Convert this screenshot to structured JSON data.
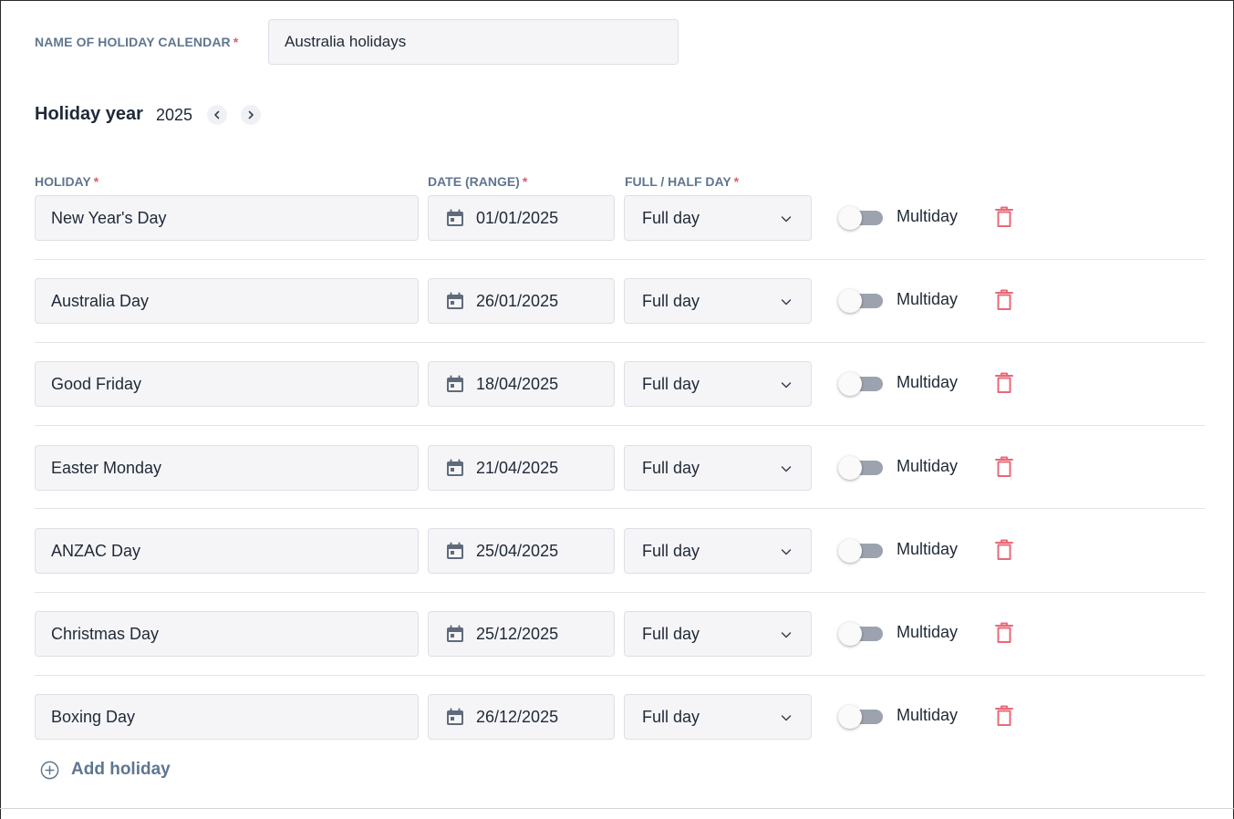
{
  "calendar_name": {
    "label": "NAME OF HOLIDAY CALENDAR",
    "required_mark": "*",
    "value": "Australia holidays"
  },
  "holiday_year": {
    "title": "Holiday year",
    "value": "2025",
    "prev_icon": "chevron-left-icon",
    "next_icon": "chevron-right-icon"
  },
  "columns": {
    "holiday": "HOLIDAY",
    "date": "DATE (RANGE)",
    "day_type": "FULL / HALF DAY",
    "required_mark": "*"
  },
  "holidays": [
    {
      "name": "New Year's Day",
      "date": "01/01/2025",
      "type": "Full day",
      "multiday_label": "Multiday",
      "multiday": false
    },
    {
      "name": "Australia Day",
      "date": "26/01/2025",
      "type": "Full day",
      "multiday_label": "Multiday",
      "multiday": false
    },
    {
      "name": "Good Friday",
      "date": "18/04/2025",
      "type": "Full day",
      "multiday_label": "Multiday",
      "multiday": false
    },
    {
      "name": "Easter Monday",
      "date": "21/04/2025",
      "type": "Full day",
      "multiday_label": "Multiday",
      "multiday": false
    },
    {
      "name": "ANZAC Day",
      "date": "25/04/2025",
      "type": "Full day",
      "multiday_label": "Multiday",
      "multiday": false
    },
    {
      "name": "Christmas Day",
      "date": "25/12/2025",
      "type": "Full day",
      "multiday_label": "Multiday",
      "multiday": false
    },
    {
      "name": "Boxing Day",
      "date": "26/12/2025",
      "type": "Full day",
      "multiday_label": "Multiday",
      "multiday": false
    }
  ],
  "add_holiday": {
    "label": "Add holiday",
    "icon": "plus-circle-icon"
  },
  "colors": {
    "label_blue": "#5f7690",
    "required_red": "#e05b6a",
    "delete_red": "#e86a78",
    "field_bg": "#f5f5f8",
    "toggle_off": "#9ca3af"
  }
}
